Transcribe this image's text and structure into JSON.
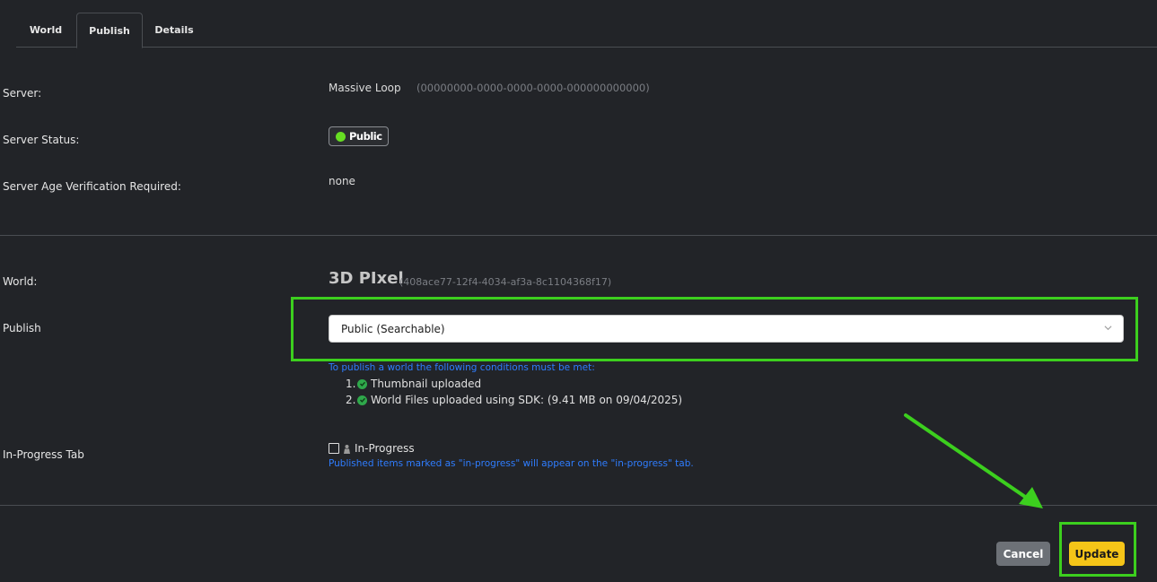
{
  "tabs": [
    {
      "label": "World"
    },
    {
      "label": "Publish"
    },
    {
      "label": "Details"
    }
  ],
  "server": {
    "label": "Server:",
    "name": "Massive Loop",
    "id": "(00000000-0000-0000-0000-000000000000)",
    "status_label": "Server Status:",
    "status_value": "Public",
    "age_label": "Server Age Verification Required:",
    "age_value": "none"
  },
  "world": {
    "label": "World:",
    "name": "3D PIxel",
    "id": "(408ace77-12f4-4034-af3a-8c1104368f17)"
  },
  "publish": {
    "label": "Publish",
    "selected": "Public (Searchable)",
    "conditions_title": "To publish a world the following conditions must be met:",
    "conditions": [
      {
        "num": "1.",
        "text": "Thumbnail uploaded"
      },
      {
        "num": "2.",
        "text": "World Files uploaded using SDK: (9.41 MB on 09/04/2025)"
      }
    ]
  },
  "in_progress": {
    "label": "In-Progress Tab",
    "checkbox_label": "In-Progress",
    "note": "Published items marked as \"in-progress\" will appear on the \"in-progress\" tab."
  },
  "actions": {
    "cancel": "Cancel",
    "update": "Update"
  },
  "colors": {
    "highlight": "#3ccf1e",
    "status_dot": "#66dd22",
    "update_button": "#f5c518",
    "link_blue": "#2f7dff"
  }
}
